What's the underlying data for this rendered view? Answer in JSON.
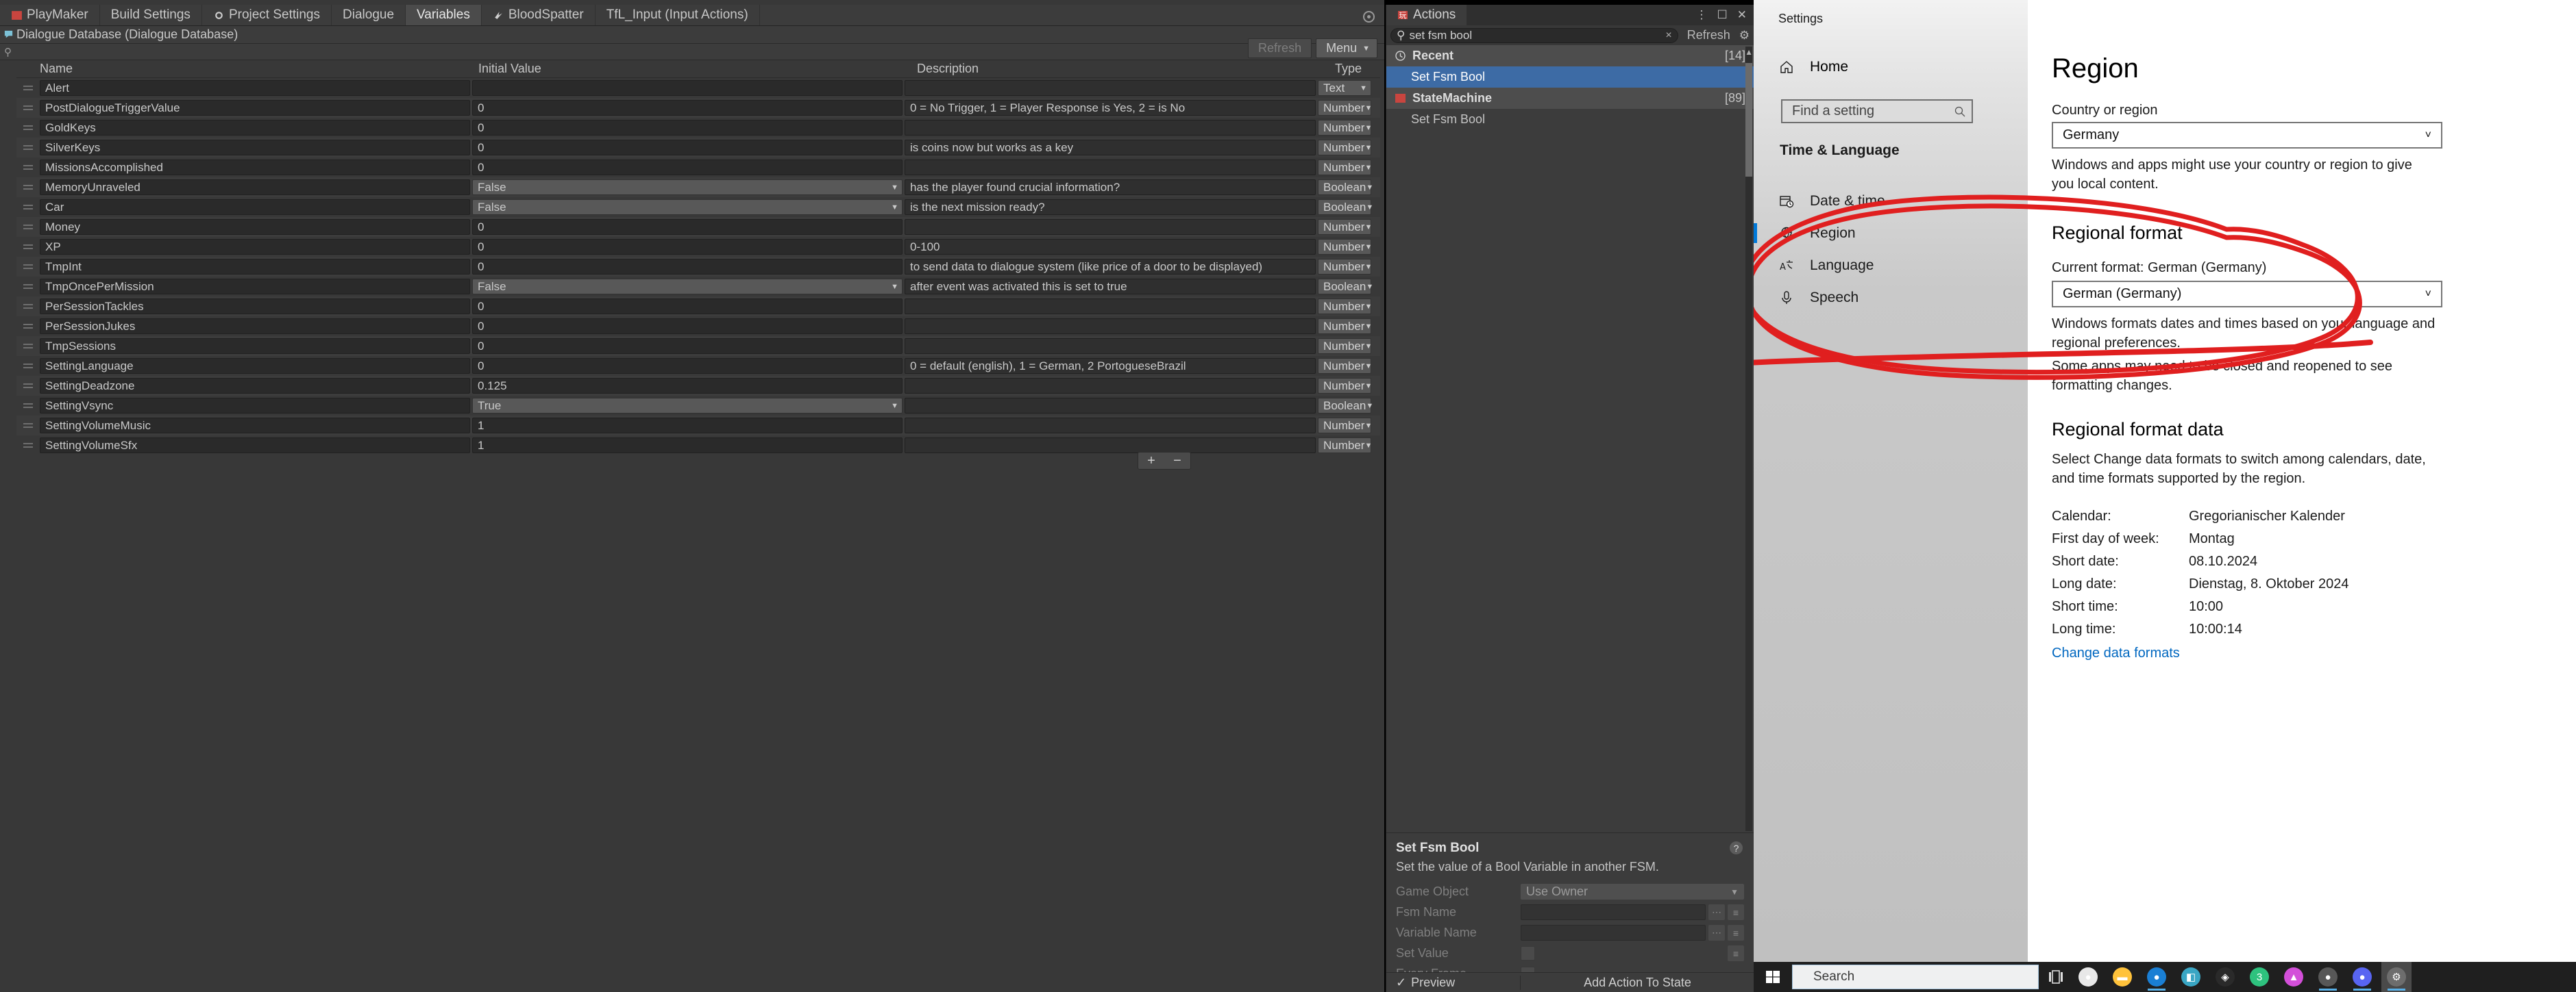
{
  "unity": {
    "toolbar_tabs": [
      {
        "label": "PlayMaker",
        "icon": "playmaker-icon",
        "active": false
      },
      {
        "label": "Build Settings",
        "icon": "",
        "active": false
      },
      {
        "label": "Project Settings",
        "icon": "gear-icon",
        "active": false
      },
      {
        "label": "Dialogue",
        "icon": "",
        "active": false
      },
      {
        "label": "Variables",
        "icon": "",
        "active": true
      },
      {
        "label": "BloodSpatter",
        "icon": "blood-icon",
        "active": false
      },
      {
        "label": "TfL_Input (Input Actions)",
        "icon": "",
        "active": false
      }
    ],
    "breadcrumb": "Dialogue Database (Dialogue Database)",
    "search_placeholder": "",
    "refresh_label": "Refresh",
    "menu_label": "Menu",
    "add_label": "+",
    "remove_label": "−",
    "columns": [
      "Name",
      "Initial Value",
      "Description",
      "Type"
    ],
    "rows": [
      {
        "name": "Alert",
        "value": "",
        "desc": "",
        "type": "Text",
        "popup": false
      },
      {
        "name": "PostDialogueTriggerValue",
        "value": "0",
        "desc": "0 = No Trigger, 1 = Player Response is Yes, 2 = is No",
        "type": "Number",
        "popup": false
      },
      {
        "name": "GoldKeys",
        "value": "0",
        "desc": "",
        "type": "Number",
        "popup": false
      },
      {
        "name": "SilverKeys",
        "value": "0",
        "desc": "is coins now but works as a key",
        "type": "Number",
        "popup": false
      },
      {
        "name": "MissionsAccomplished",
        "value": "0",
        "desc": "",
        "type": "Number",
        "popup": false
      },
      {
        "name": "MemoryUnraveled",
        "value": "False",
        "desc": "has the player found crucial information?",
        "type": "Boolean",
        "popup": true
      },
      {
        "name": "Car",
        "value": "False",
        "desc": "is the next mission ready?",
        "type": "Boolean",
        "popup": true
      },
      {
        "name": "Money",
        "value": "0",
        "desc": "",
        "type": "Number",
        "popup": false
      },
      {
        "name": "XP",
        "value": "0",
        "desc": "0-100",
        "type": "Number",
        "popup": false
      },
      {
        "name": "TmpInt",
        "value": "0",
        "desc": "to send data to dialogue system (like price of a door to be displayed)",
        "type": "Number",
        "popup": false
      },
      {
        "name": "TmpOncePerMission",
        "value": "False",
        "desc": "after event was activated this is set to true",
        "type": "Boolean",
        "popup": true
      },
      {
        "name": "PerSessionTackles",
        "value": "0",
        "desc": "",
        "type": "Number",
        "popup": false
      },
      {
        "name": "PerSessionJukes",
        "value": "0",
        "desc": "",
        "type": "Number",
        "popup": false
      },
      {
        "name": "TmpSessions",
        "value": "0",
        "desc": "",
        "type": "Number",
        "popup": false
      },
      {
        "name": "SettingLanguage",
        "value": "0",
        "desc": "0 = default (english), 1 = German, 2 PortogueseBrazil",
        "type": "Number",
        "popup": false
      },
      {
        "name": "SettingDeadzone",
        "value": "0.125",
        "desc": "",
        "type": "Number",
        "popup": false
      },
      {
        "name": "SettingVsync",
        "value": "True",
        "desc": "",
        "type": "Boolean",
        "popup": true
      },
      {
        "name": "SettingVolumeMusic",
        "value": "1",
        "desc": "",
        "type": "Number",
        "popup": false
      },
      {
        "name": "SettingVolumeSfx",
        "value": "1",
        "desc": "",
        "type": "Number",
        "popup": false
      }
    ]
  },
  "actions": {
    "window_title": "Actions",
    "search_value": "set fsm bool",
    "clear_label": "×",
    "refresh_label": "Refresh",
    "groups": [
      {
        "label": "Recent",
        "count": "[14]",
        "icon": "clock-icon",
        "items": [
          {
            "label": "Set Fsm Bool",
            "selected": true
          }
        ]
      },
      {
        "label": "StateMachine",
        "count": "[89]",
        "icon": "playmaker-icon",
        "items": [
          {
            "label": "Set Fsm Bool",
            "selected": false
          }
        ]
      }
    ],
    "detail": {
      "title": "Set Fsm Bool",
      "description": "Set the value of a Bool Variable in another FSM.",
      "help_label": "?",
      "fields": [
        {
          "label": "Game Object",
          "value": "Use Owner",
          "kind": "popup"
        },
        {
          "label": "Fsm Name",
          "value": "",
          "kind": "text"
        },
        {
          "label": "Variable Name",
          "value": "",
          "kind": "text"
        },
        {
          "label": "Set Value",
          "value": "",
          "kind": "checkbox"
        },
        {
          "label": "Every Frame",
          "value": "",
          "kind": "checkbox"
        }
      ]
    },
    "preview_label": "Preview",
    "add_action_label": "Add Action To State"
  },
  "settings": {
    "window_title": "Settings",
    "home_label": "Home",
    "search_placeholder": "Find a setting",
    "category": "Time & Language",
    "nav": [
      {
        "label": "Date & time",
        "icon": "calendar-clock-icon",
        "active": false
      },
      {
        "label": "Region",
        "icon": "globe-icon",
        "active": true
      },
      {
        "label": "Language",
        "icon": "language-icon",
        "active": false
      },
      {
        "label": "Speech",
        "icon": "microphone-icon",
        "active": false
      }
    ],
    "page_title": "Region",
    "country_label": "Country or region",
    "country_value": "Germany",
    "country_help": "Windows and apps might use your country or region to give you local content.",
    "regional_format_heading": "Regional format",
    "current_format_label": "Current format: German (Germany)",
    "format_value": "German (Germany)",
    "format_help": "Windows formats dates and times based on your language and regional preferences.",
    "format_warning": "Some apps may need to be closed and reopened to see formatting changes.",
    "format_data_heading": "Regional format data",
    "format_data_help": "Select Change data formats to switch among calendars, date, and time formats supported by the region.",
    "format_data": [
      {
        "key": "Calendar:",
        "value": "Gregorianischer Kalender"
      },
      {
        "key": "First day of week:",
        "value": "Montag"
      },
      {
        "key": "Short date:",
        "value": "08.10.2024"
      },
      {
        "key": "Long date:",
        "value": "Dienstag, 8. Oktober 2024"
      },
      {
        "key": "Short time:",
        "value": "10:00"
      },
      {
        "key": "Long time:",
        "value": "10:00:14"
      }
    ],
    "change_data_formats_link": "Change data formats",
    "annotation_color": "#e01f1f"
  },
  "taskbar": {
    "search_placeholder": "Search",
    "icons": [
      {
        "name": "chrome-icon",
        "color": "#e8e8e8",
        "glyph": "●",
        "running": false
      },
      {
        "name": "file-explorer-icon",
        "color": "#ffc23b",
        "glyph": "▬",
        "running": false
      },
      {
        "name": "browser-blue-icon",
        "color": "#1a7fd4",
        "glyph": "●",
        "running": true
      },
      {
        "name": "app-teal-icon",
        "color": "#3aa6c4",
        "glyph": "◧",
        "running": false
      },
      {
        "name": "app-dark-icon",
        "color": "#2a2a2a",
        "glyph": "◈",
        "running": false
      },
      {
        "name": "app-green-icon",
        "color": "#2ec27e",
        "glyph": "3",
        "running": false
      },
      {
        "name": "app-magenta-icon",
        "color": "#d34fd9",
        "glyph": "▲",
        "running": false
      },
      {
        "name": "app-gray-icon",
        "color": "#575757",
        "glyph": "●",
        "running": true
      },
      {
        "name": "discord-icon",
        "color": "#5865f2",
        "glyph": "●",
        "running": true
      },
      {
        "name": "settings-gear-icon",
        "color": "#6d6d6d",
        "glyph": "⚙",
        "running": true
      }
    ]
  }
}
